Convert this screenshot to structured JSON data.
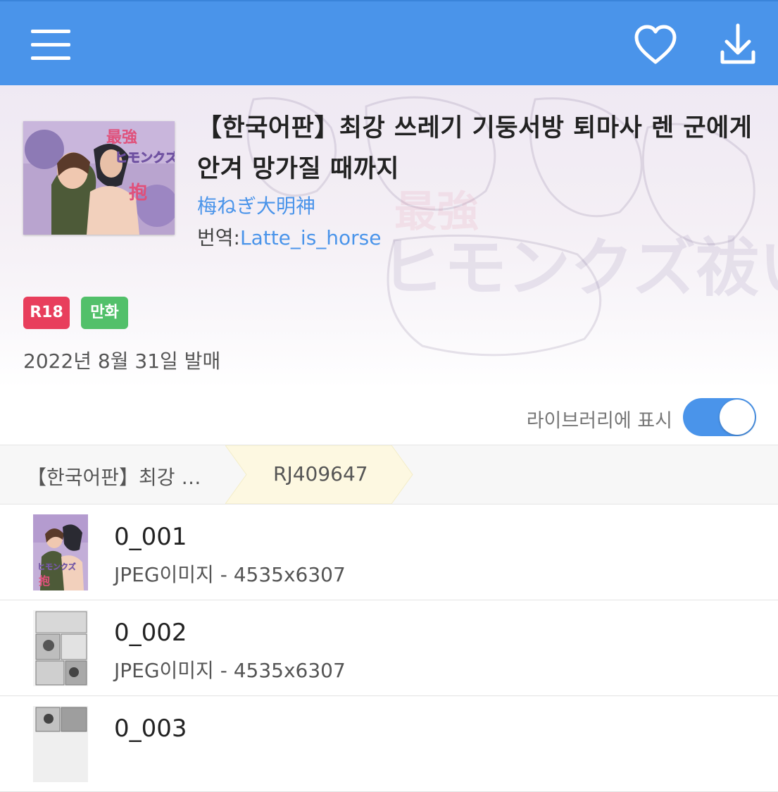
{
  "appbar": {
    "menu_icon": "menu-icon",
    "favorite_icon": "heart-icon",
    "download_icon": "download-icon",
    "color": "#4a94ea"
  },
  "work": {
    "title": "【한국어판】최강 쓰레기 기둥서방 퇴마사 렌 군에게 안겨 망가질 때까지",
    "author": "梅ねぎ大明神",
    "translator_label": "번역:",
    "translator": "Latte_is_horse",
    "tags": [
      "R18",
      "만화"
    ],
    "release_date": "2022년 8월 31일 발매"
  },
  "library": {
    "label": "라이브러리에 표시",
    "enabled": true
  },
  "breadcrumb": {
    "items": [
      "【한국어판】최강 …",
      "RJ409647"
    ]
  },
  "files": [
    {
      "name": "0_001",
      "meta": "JPEG이미지 - 4535x6307"
    },
    {
      "name": "0_002",
      "meta": "JPEG이미지 - 4535x6307"
    },
    {
      "name": "0_003",
      "meta": ""
    }
  ]
}
